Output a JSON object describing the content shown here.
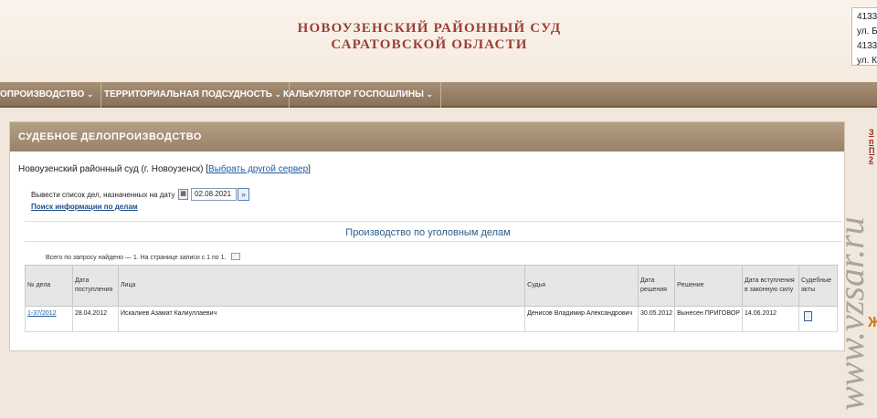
{
  "header": {
    "title_line1": "НОВОУЗЕНСКИЙ РАЙОННЫЙ СУД",
    "title_line2": "САРАТОВСКОЙ ОБЛАСТИ",
    "address_lines": [
      "4133",
      "ул. Б",
      "4133",
      "ул. К"
    ]
  },
  "nav": {
    "items": [
      {
        "label": "ОПРОИЗВОДСТВО"
      },
      {
        "label": "ТЕРРИТОРИАЛЬНАЯ ПОДСУДНОСТЬ"
      },
      {
        "label": "КАЛЬКУЛЯТОР ГОСПОШЛИНЫ"
      }
    ]
  },
  "panel": {
    "title": "СУДЕБНОЕ ДЕЛОПРОИЗВОДСТВО",
    "server_text": "Новоузенский районный суд (г. Новоузенск) [",
    "server_link": "Выбрать другой сервер",
    "server_suffix": "]",
    "date_label": "Вывести список дел, назначенных на дату",
    "date_value": "02.08.2021",
    "search_link": "Поиск информации по делам",
    "section_title": "Производство по уголовным делам",
    "found_text": "Всего по запросу найдено — 1. На странице записи с 1 по 1."
  },
  "table": {
    "headers": [
      "№ дела",
      "Дата поступления",
      "Лица",
      "Судья",
      "Дата решения",
      "Решение",
      "Дата вступления в законную силу",
      "Судебные акты"
    ],
    "rows": [
      {
        "case_no": "1-37/2012",
        "received": "28.04.2012",
        "persons": "Искалиев Азамат Калиуллаевич",
        "judge": "Денисов Владимир Александрович",
        "decision_date": "30.05.2012",
        "decision": "Вынесен ПРИГОВОР",
        "effective_date": "14.06.2012"
      }
    ]
  },
  "side": {
    "watermark": "www.vzsar.ru",
    "link_text": "З п П 2"
  }
}
